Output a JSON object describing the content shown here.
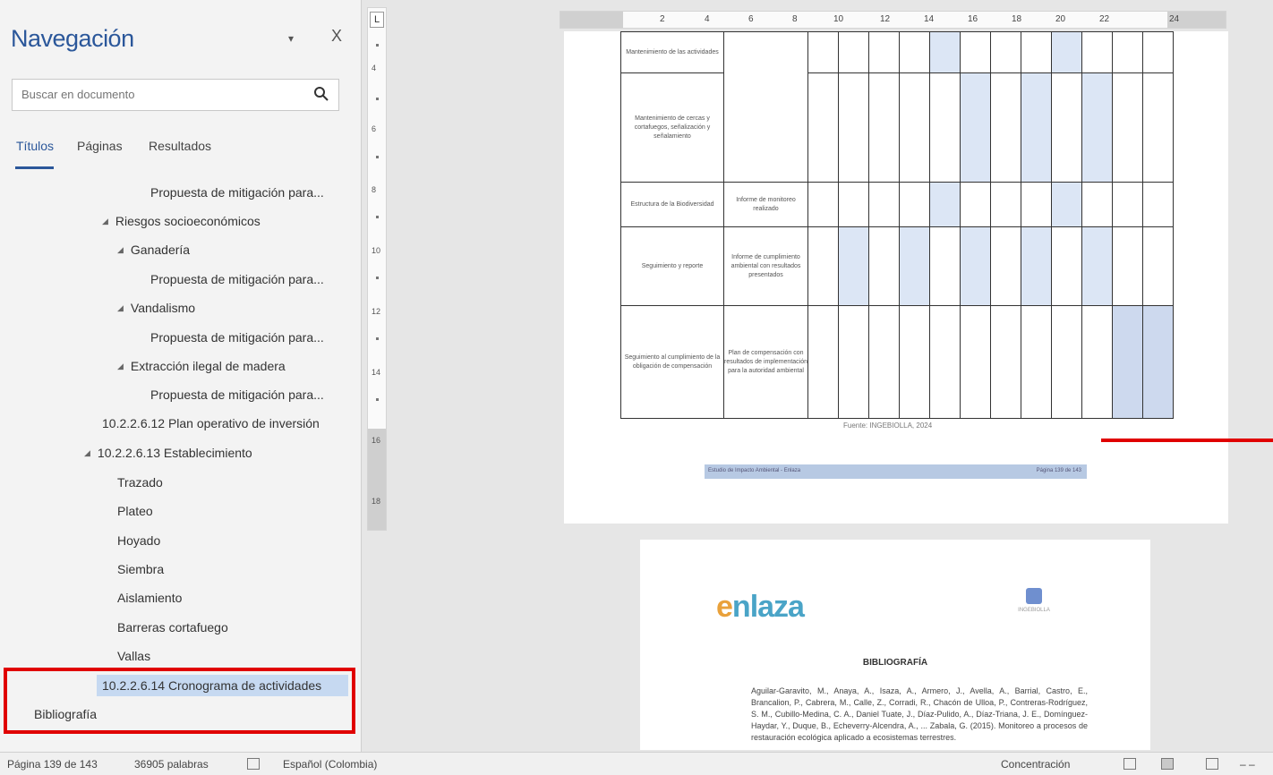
{
  "nav": {
    "title": "Navegación",
    "dropdown_glyph": "▾",
    "close_glyph": "X",
    "search_placeholder": "Buscar en documento",
    "tabs": [
      "Títulos",
      "Páginas",
      "Resultados"
    ],
    "tree": [
      {
        "label": "Propuesta de mitigación para...",
        "expander": ""
      },
      {
        "label": "Riesgos socioeconómicos",
        "expander": "◢"
      },
      {
        "label": "Ganadería",
        "expander": "◢"
      },
      {
        "label": "Propuesta de mitigación para...",
        "expander": ""
      },
      {
        "label": "Vandalismo",
        "expander": "◢"
      },
      {
        "label": "Propuesta de mitigación para...",
        "expander": ""
      },
      {
        "label": "Extracción ilegal de madera",
        "expander": "◢"
      },
      {
        "label": "Propuesta de mitigación para...",
        "expander": ""
      },
      {
        "label": "10.2.2.6.12 Plan operativo de inversión",
        "expander": ""
      },
      {
        "label": "10.2.2.6.13 Establecimiento",
        "expander": "◢"
      },
      {
        "label": "Trazado",
        "expander": ""
      },
      {
        "label": "Plateo",
        "expander": ""
      },
      {
        "label": "Hoyado",
        "expander": ""
      },
      {
        "label": "Siembra",
        "expander": ""
      },
      {
        "label": "Aislamiento",
        "expander": ""
      },
      {
        "label": "Barreras cortafuego",
        "expander": ""
      },
      {
        "label": "Vallas",
        "expander": ""
      },
      {
        "label": "10.2.2.6.14 Cronograma de actividades",
        "expander": "",
        "selected": true
      },
      {
        "label": "Bibliografía",
        "expander": ""
      }
    ]
  },
  "vruler": {
    "corner": "L",
    "numbers": [
      "4",
      "6",
      "8",
      "10",
      "12",
      "14",
      "16",
      "18"
    ]
  },
  "hruler": {
    "numbers": [
      "2",
      "4",
      "6",
      "8",
      "10",
      "12",
      "14",
      "16",
      "18",
      "20",
      "22",
      "24"
    ]
  },
  "page1": {
    "rows": [
      {
        "activity": "Mantenimiento de las actividades",
        "product": ""
      },
      {
        "activity": "Mantenimiento de cercas y cortafuegos, señalización y señalamiento",
        "product": ""
      },
      {
        "activity": "Estructura de la Biodiversidad",
        "product": "Informe de monitoreo realizado"
      },
      {
        "activity": "Seguimiento y reporte",
        "product": "Informe de cumplimiento ambiental con resultados presentados"
      },
      {
        "activity": "Seguimiento al cumplimiento de la obligación de compensación",
        "product": "Plan de compensación con resultados de implementación para la autoridad ambiental"
      }
    ],
    "caption": "Fuente: INGEBIOLLA, 2024",
    "footer_left": "Estudio de Impacto Ambiental - Enlaza",
    "footer_right": "Página 139 de 143"
  },
  "page2": {
    "logo_lead": "e",
    "logo_rest": "nlaza",
    "logo_right": "INGEBIOLLA",
    "bib_title": "BIBLIOGRAFÍA",
    "bib_text": "Aguilar-Garavito, M., Anaya, A., Isaza, A., Armero, J., Avella, A., Barrial, Castro, E., Brancalion, P., Cabrera, M., Calle, Z., Corradi, R., Chacón de Ulloa, P., Contreras-Rodríguez, S. M., Cubillo-Medina, C. A., Daniel Tuate, J., Díaz-Pulido, A., Díaz-Triana, J. E., Domínguez-Haydar, Y., Duque, B., Echeverry-Alcendra, A., ... Zabala, G. (2015). Monitoreo a procesos de restauración ecológica aplicado a ecosistemas terrestres."
  },
  "status": {
    "page": "Página 139 de 143",
    "words": "36905 palabras",
    "language": "Español (Colombia)",
    "focus": "Concentración"
  }
}
